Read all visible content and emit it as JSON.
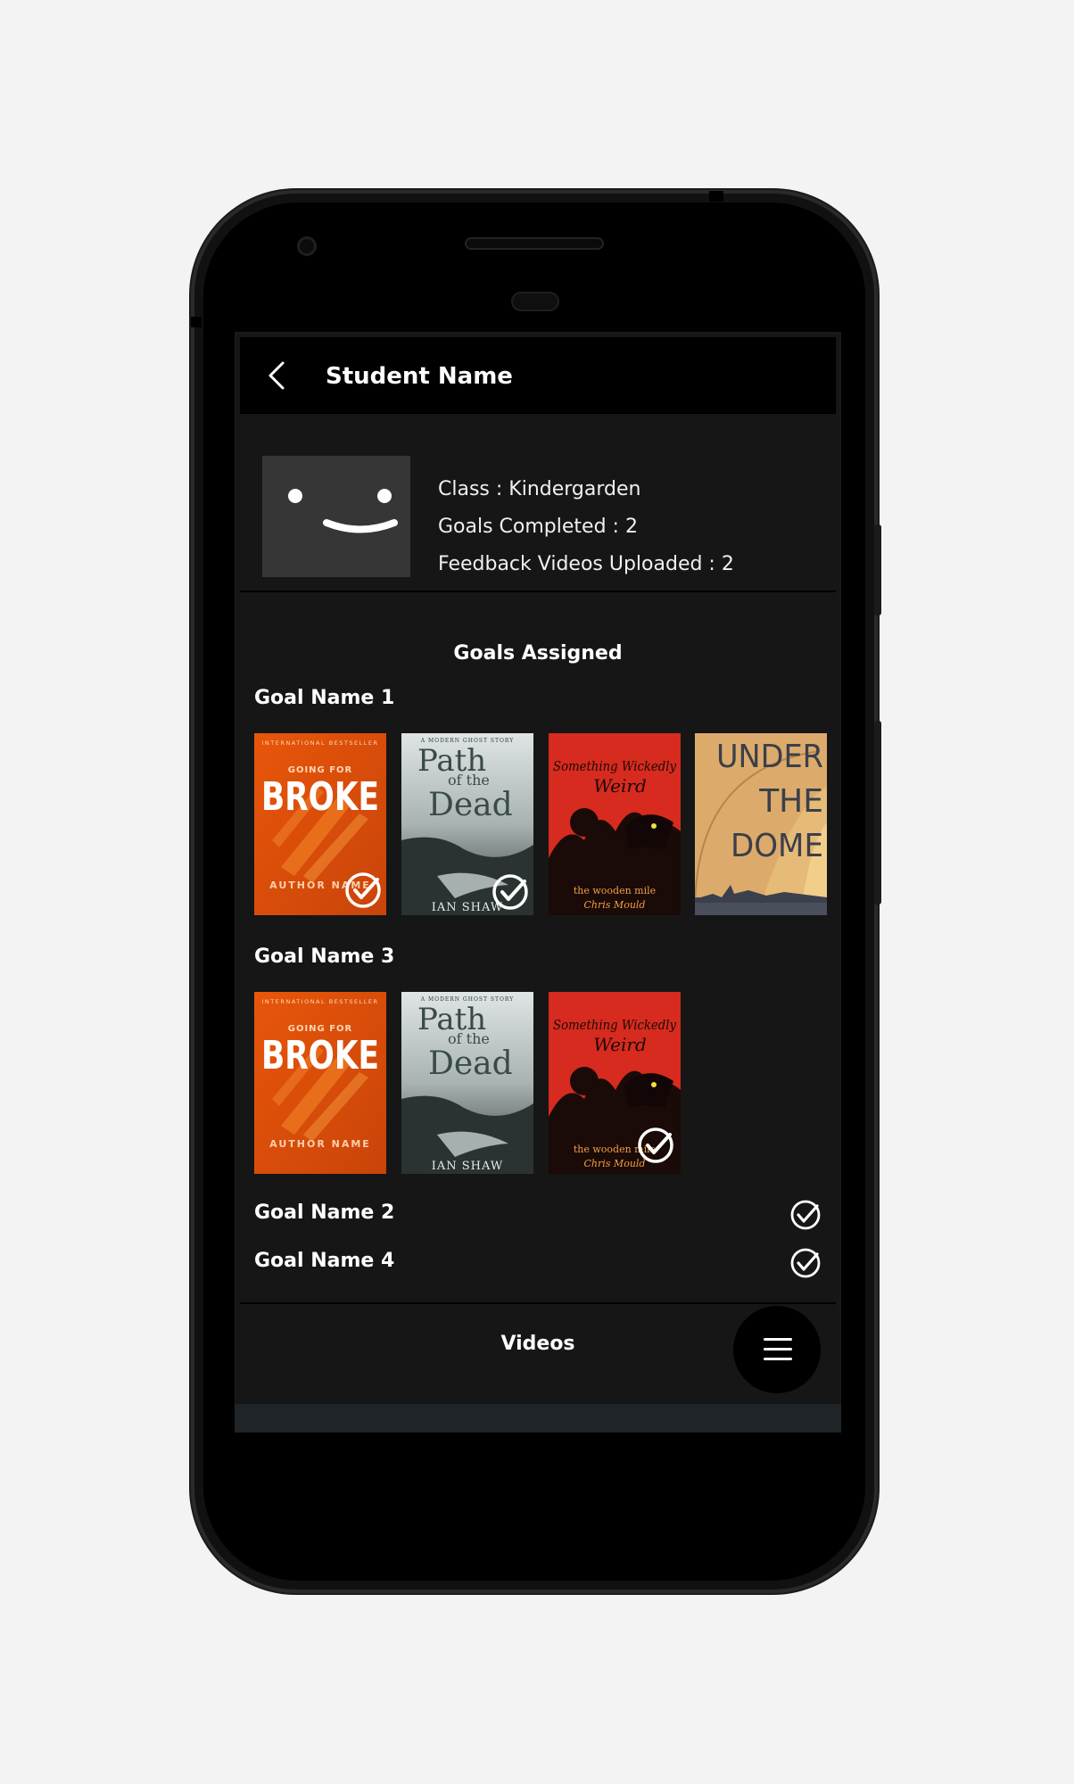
{
  "header": {
    "title": "Student Name",
    "back_icon": "chevron-left-icon"
  },
  "profile": {
    "avatar_icon": "smiley-face-icon",
    "class_line": "Class : Kindergarden",
    "goals_completed_line": "Goals Completed : 2",
    "videos_uploaded_line": "Feedback Videos Uploaded : 2"
  },
  "goals": {
    "heading": "Goals Assigned",
    "expanded": [
      {
        "name": "Goal Name 1",
        "books": [
          {
            "title": "Going for Broke",
            "cover_top": "INTERNATIONAL BESTSELLER",
            "cover_sub": "GOING FOR",
            "cover_main": "BROKE",
            "cover_author": "AUTHOR NAME",
            "completed": true
          },
          {
            "title": "Path of the Dead",
            "cover_top": "A MODERN GHOST STORY",
            "cover_main1": "Path",
            "cover_main2": "of the",
            "cover_main3": "Dead",
            "cover_author": "IAN SHAW",
            "completed": true
          },
          {
            "title": "Something Wickedly Weird",
            "cover_main1": "Something Wickedly",
            "cover_main2": "Weird",
            "cover_sub": "the wooden mile",
            "cover_author": "Chris Mould",
            "completed": false
          },
          {
            "title": "Under the Dome",
            "cover_main1": "UNDER",
            "cover_main2": "THE",
            "cover_main3": "DOME",
            "completed": false
          }
        ]
      },
      {
        "name": "Goal Name 3",
        "books": [
          {
            "title": "Going for Broke",
            "cover_top": "INTERNATIONAL BESTSELLER",
            "cover_sub": "GOING FOR",
            "cover_main": "BROKE",
            "cover_author": "AUTHOR NAME",
            "completed": false
          },
          {
            "title": "Path of the Dead",
            "cover_top": "A MODERN GHOST STORY",
            "cover_main1": "Path",
            "cover_main2": "of the",
            "cover_main3": "Dead",
            "cover_author": "IAN SHAW",
            "completed": false
          },
          {
            "title": "Something Wickedly Weird",
            "cover_main1": "Something Wickedly",
            "cover_main2": "Weird",
            "cover_sub": "the wooden mile",
            "cover_author": "Chris Mould",
            "completed": true
          }
        ]
      }
    ],
    "collapsed": [
      {
        "name": "Goal Name 2",
        "completed": true
      },
      {
        "name": "Goal Name 4",
        "completed": true
      }
    ]
  },
  "bottom": {
    "videos_label": "Videos",
    "menu_icon": "hamburger-menu-icon"
  },
  "colors": {
    "header_bg": "#000000",
    "screen_bg": "#161616",
    "avatar_bg": "#363636",
    "text": "#ffffff",
    "broke_orange": "#e2570d",
    "weird_red": "#d42a1f",
    "dome_tan": "#d9a96a"
  }
}
